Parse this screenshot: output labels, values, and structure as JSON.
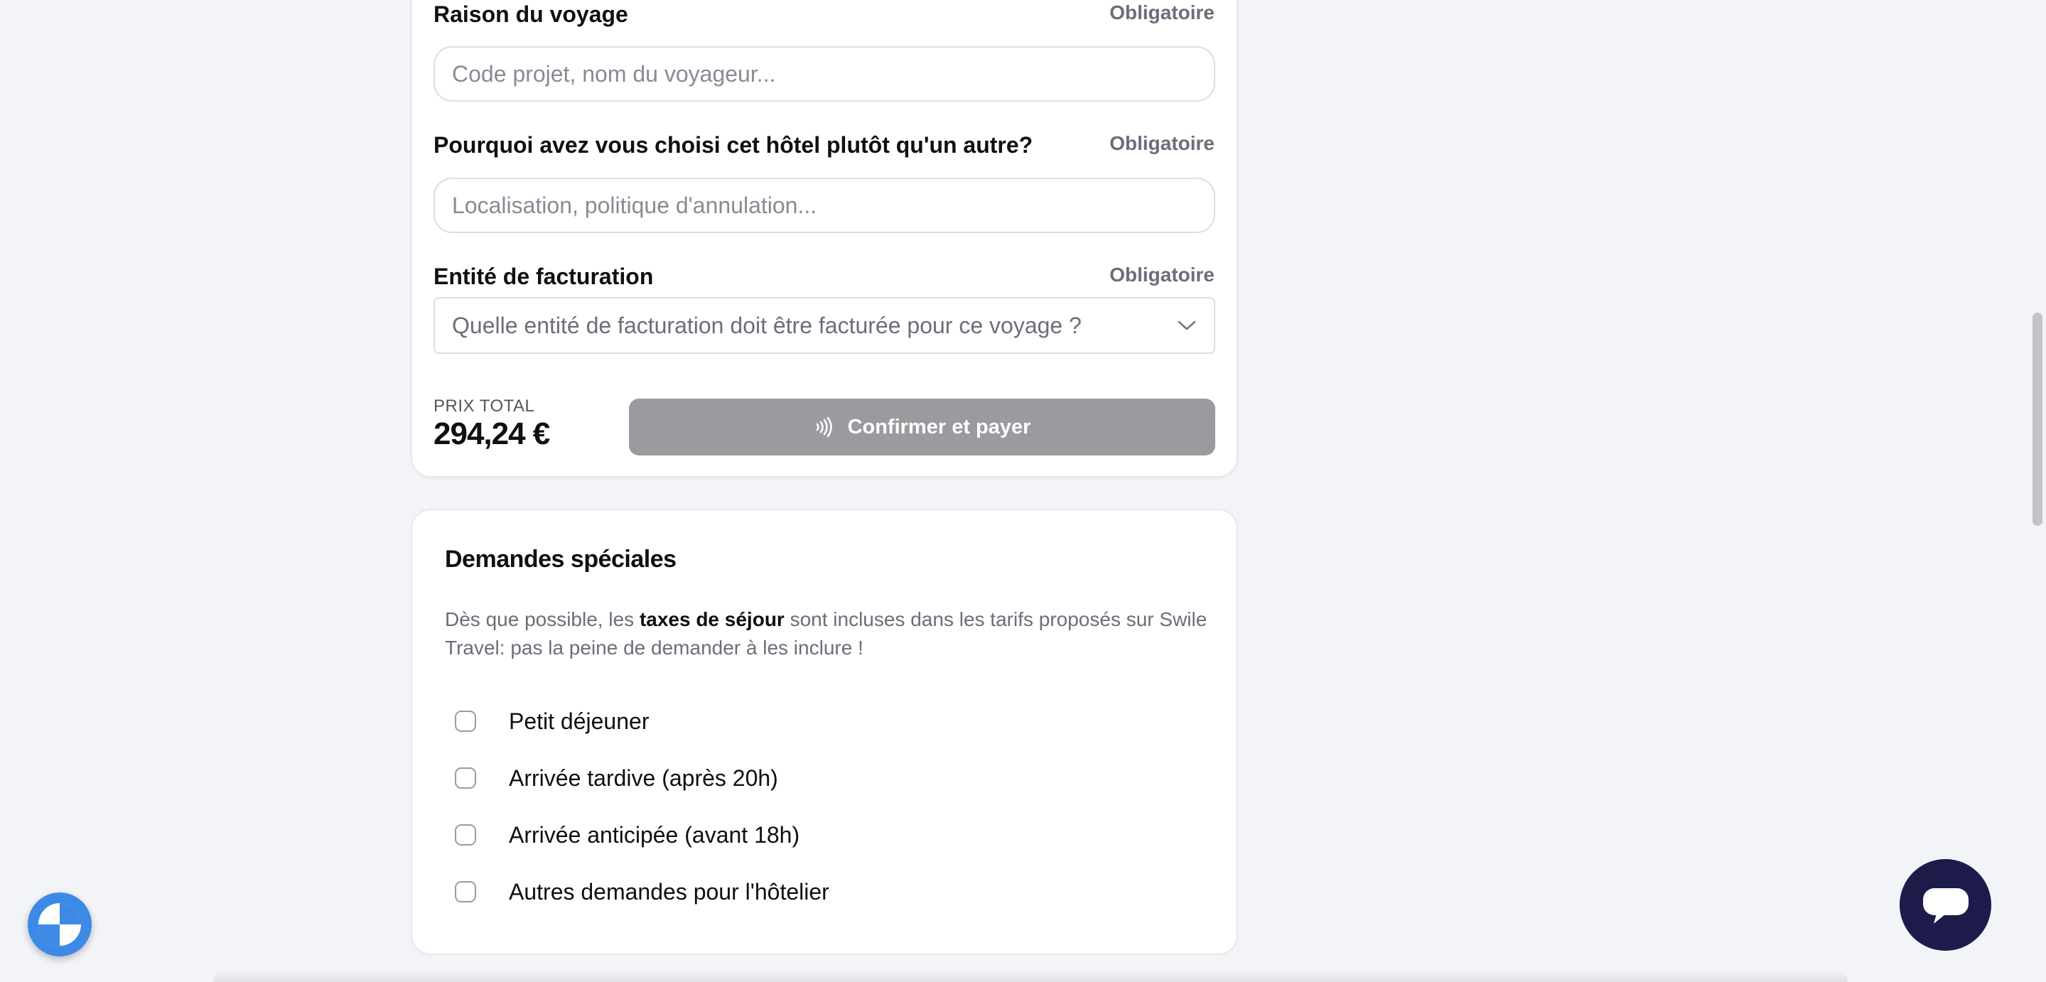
{
  "form": {
    "fields": [
      {
        "label": "Raison du voyage",
        "required": "Obligatoire",
        "placeholder": "Code projet, nom du voyageur..."
      },
      {
        "label": "Pourquoi avez vous choisi cet hôtel plutôt qu'un autre?",
        "required": "Obligatoire",
        "placeholder": "Localisation, politique d'annulation..."
      },
      {
        "label": "Entité de facturation",
        "required": "Obligatoire",
        "placeholder": "Quelle entité de facturation doit être facturée pour ce voyage ?"
      }
    ],
    "total_label": "PRIX TOTAL",
    "total_value": "294,24 €",
    "pay_button": "Confirmer et payer"
  },
  "special_requests": {
    "title": "Demandes spéciales",
    "desc_before": "Dès que possible, les ",
    "desc_bold": "taxes de séjour",
    "desc_after": " sont incluses dans les tarifs proposés sur Swile Travel: pas la peine de demander à les inclure !",
    "options": [
      {
        "label": "Petit déjeuner",
        "checked": false
      },
      {
        "label": "Arrivée tardive (après 20h)",
        "checked": false
      },
      {
        "label": "Arrivée anticipée (avant 18h)",
        "checked": false
      },
      {
        "label": "Autres demandes pour l'hôtelier",
        "checked": false
      }
    ]
  },
  "icons": {
    "pay": "contactless-icon",
    "select": "chevron-down-icon",
    "chat": "chat-bubble-icon",
    "assistant": "assistant-logo-icon"
  },
  "colors": {
    "background": "#f3f4f8",
    "pay_button_disabled": "#9b9b9f",
    "chat_button": "#1c1b4a",
    "assistant_button": "#3d8ae6"
  }
}
